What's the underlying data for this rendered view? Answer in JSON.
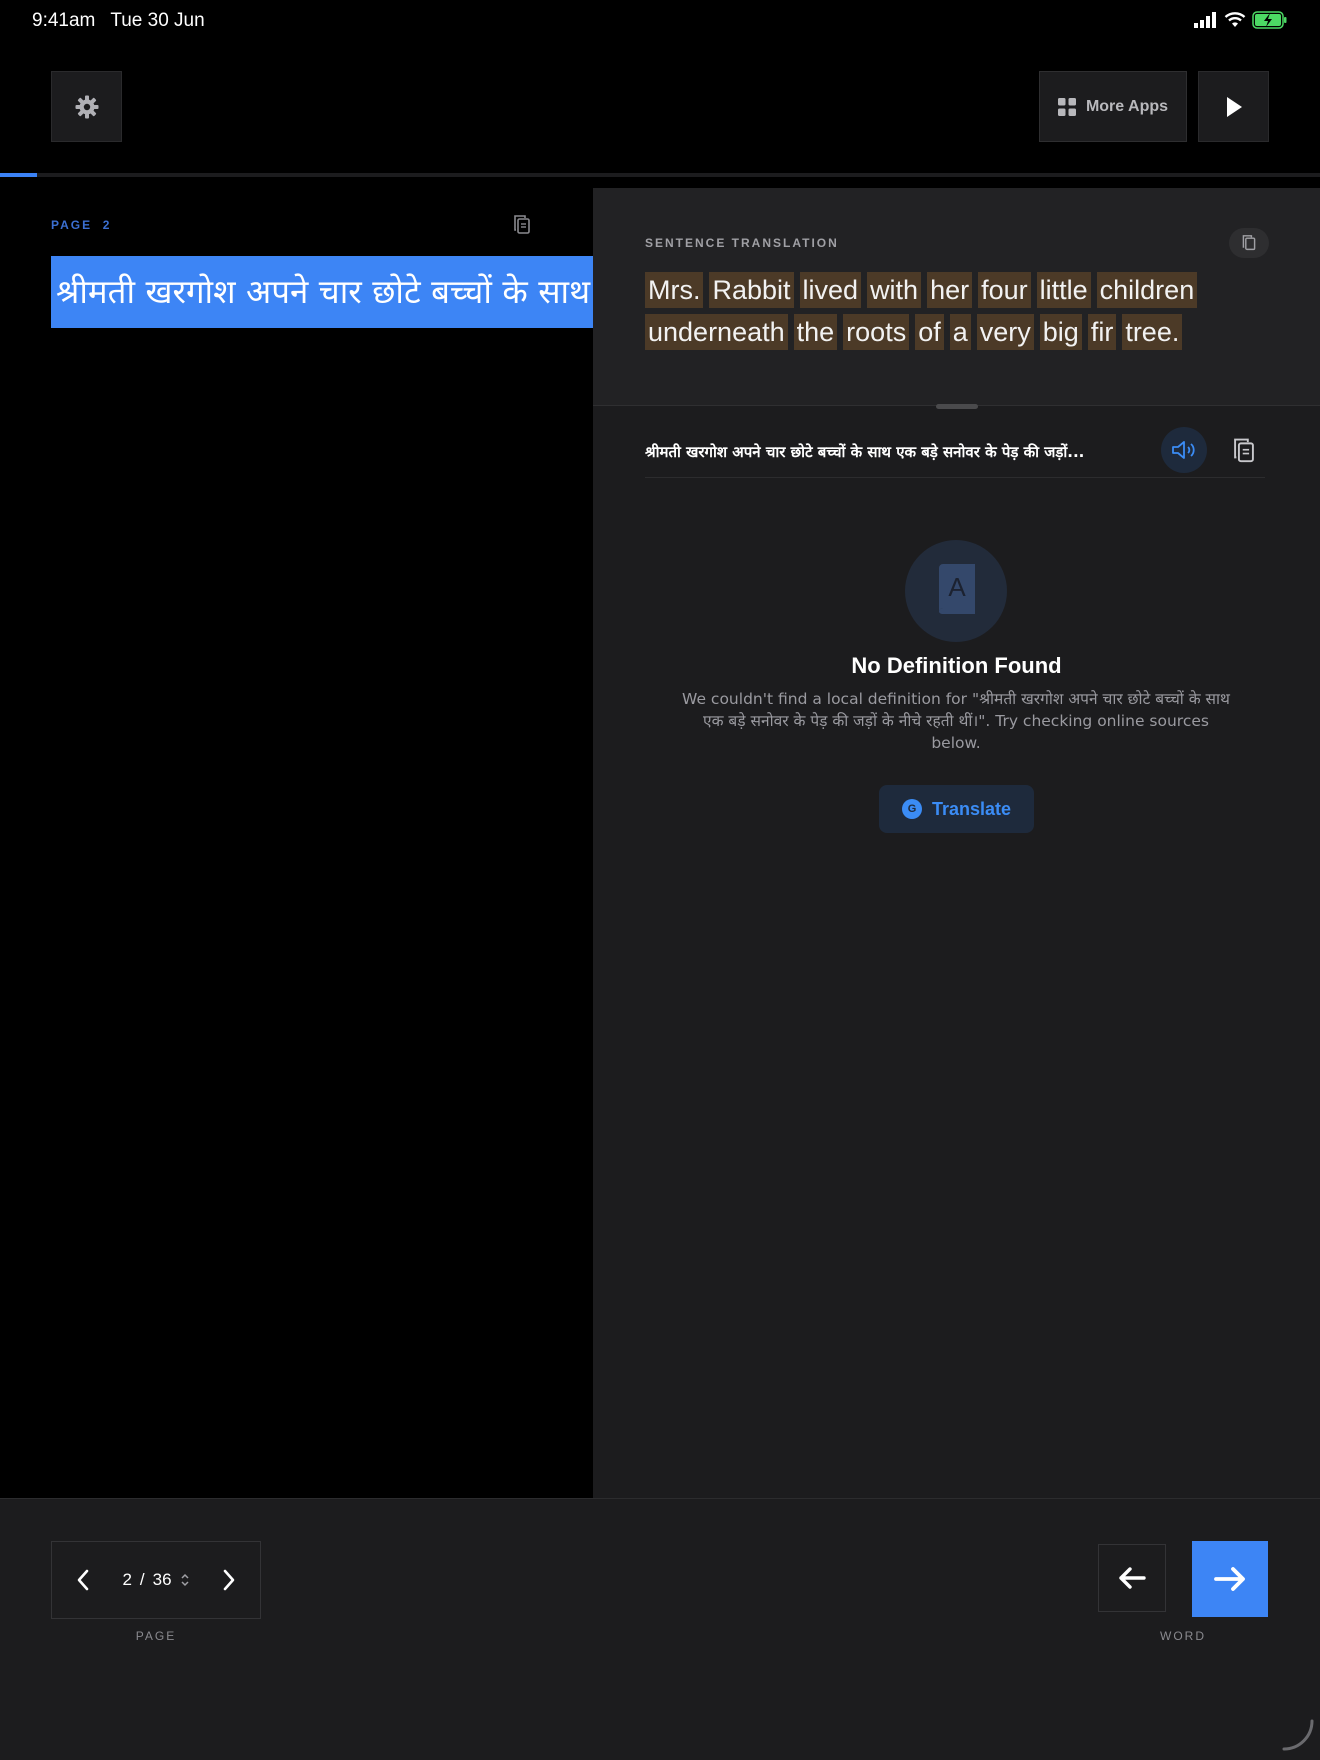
{
  "status_bar": {
    "time": "9:41am",
    "date": "Tue 30 Jun"
  },
  "toolbar": {
    "more_apps_label": "More Apps"
  },
  "progress": {
    "fraction": 0.028
  },
  "page_panel": {
    "page_label": "PAGE",
    "page_number": "2",
    "source_text": "श्रीमती खरगोश अपने चार छोटे बच्चों के साथ एक बड़े सनोवर के पेड़ की जड़ों के नीचे रहती थीं।"
  },
  "translation": {
    "label": "SENTENCE TRANSLATION",
    "words": [
      "Mrs.",
      "Rabbit",
      "lived",
      "with",
      "her",
      "four",
      "little",
      "children",
      "underneath",
      "the",
      "roots",
      "of",
      "a",
      "very",
      "big",
      "fir",
      "tree."
    ]
  },
  "word_row": {
    "text": "श्रीमती खरगोश अपने चार छोटे बच्चों के साथ एक बड़े सनोवर के पेड़ की जड़ों..."
  },
  "definition": {
    "icon_letter": "A",
    "title": "No Definition Found",
    "description": "We couldn't find a local definition for \"श्रीमती खरगोश अपने चार छोटे बच्चों के साथ एक बड़े सनोवर के पेड़ की जड़ों के नीचे रहती थीं।\". Try checking online sources below.",
    "translate_badge": "G",
    "translate_label": "Translate"
  },
  "pager": {
    "current": "2",
    "separator": "/",
    "total": "36",
    "label": "PAGE"
  },
  "word_nav": {
    "label": "WORD"
  },
  "colors": {
    "accent": "#3d85f5",
    "highlight": "#4c3a27",
    "panel": "#1c1c1e"
  }
}
